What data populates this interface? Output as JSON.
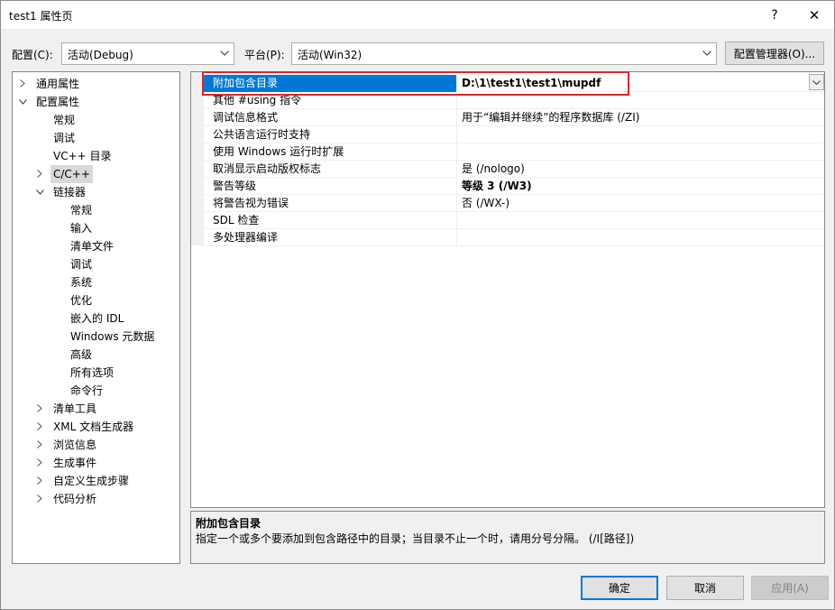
{
  "window": {
    "title": "test1 属性页",
    "help_glyph": "?",
    "close_glyph": "✕"
  },
  "config": {
    "config_label": "配置(C):",
    "config_value": "活动(Debug)",
    "platform_label": "平台(P):",
    "platform_value": "活动(Win32)",
    "manager_button": "配置管理器(O)..."
  },
  "tree": {
    "items": [
      {
        "label": "通用属性",
        "expander": "collapsed"
      },
      {
        "label": "配置属性",
        "expander": "expanded"
      },
      {
        "label": "常规",
        "expander": "none"
      },
      {
        "label": "调试",
        "expander": "none"
      },
      {
        "label": "VC++ 目录",
        "expander": "none"
      },
      {
        "label": "C/C++",
        "expander": "collapsed",
        "selected": true
      },
      {
        "label": "链接器",
        "expander": "expanded"
      },
      {
        "label": "常规",
        "expander": "none"
      },
      {
        "label": "输入",
        "expander": "none"
      },
      {
        "label": "清单文件",
        "expander": "none"
      },
      {
        "label": "调试",
        "expander": "none"
      },
      {
        "label": "系统",
        "expander": "none"
      },
      {
        "label": "优化",
        "expander": "none"
      },
      {
        "label": "嵌入的 IDL",
        "expander": "none"
      },
      {
        "label": "Windows 元数据",
        "expander": "none"
      },
      {
        "label": "高级",
        "expander": "none"
      },
      {
        "label": "所有选项",
        "expander": "none"
      },
      {
        "label": "命令行",
        "expander": "none"
      },
      {
        "label": "清单工具",
        "expander": "collapsed"
      },
      {
        "label": "XML 文档生成器",
        "expander": "collapsed"
      },
      {
        "label": "浏览信息",
        "expander": "collapsed"
      },
      {
        "label": "生成事件",
        "expander": "collapsed"
      },
      {
        "label": "自定义生成步骤",
        "expander": "collapsed"
      },
      {
        "label": "代码分析",
        "expander": "collapsed"
      }
    ]
  },
  "properties": {
    "rows": [
      {
        "name": "附加包含目录",
        "value": "D:\\1\\test1\\test1\\mupdf",
        "bold": true,
        "selected": true
      },
      {
        "name": "其他 #using 指令",
        "value": ""
      },
      {
        "name": "调试信息格式",
        "value": "用于“编辑并继续”的程序数据库 (/ZI)"
      },
      {
        "name": "公共语言运行时支持",
        "value": ""
      },
      {
        "name": "使用 Windows 运行时扩展",
        "value": ""
      },
      {
        "name": "取消显示启动版权标志",
        "value": "是 (/nologo)"
      },
      {
        "name": "警告等级",
        "value": "等级 3 (/W3)",
        "bold": true
      },
      {
        "name": "将警告视为错误",
        "value": "否 (/WX-)"
      },
      {
        "name": "SDL 检查",
        "value": ""
      },
      {
        "name": "多处理器编译",
        "value": ""
      }
    ]
  },
  "description": {
    "title": "附加包含目录",
    "body": "指定一个或多个要添加到包含路径中的目录；当目录不止一个时，请用分号分隔。     (/I[路径])"
  },
  "buttons": {
    "ok": "确定",
    "cancel": "取消",
    "apply": "应用(A)"
  },
  "colors": {
    "selection": "#0078d7",
    "highlight_box": "#e0262c"
  }
}
